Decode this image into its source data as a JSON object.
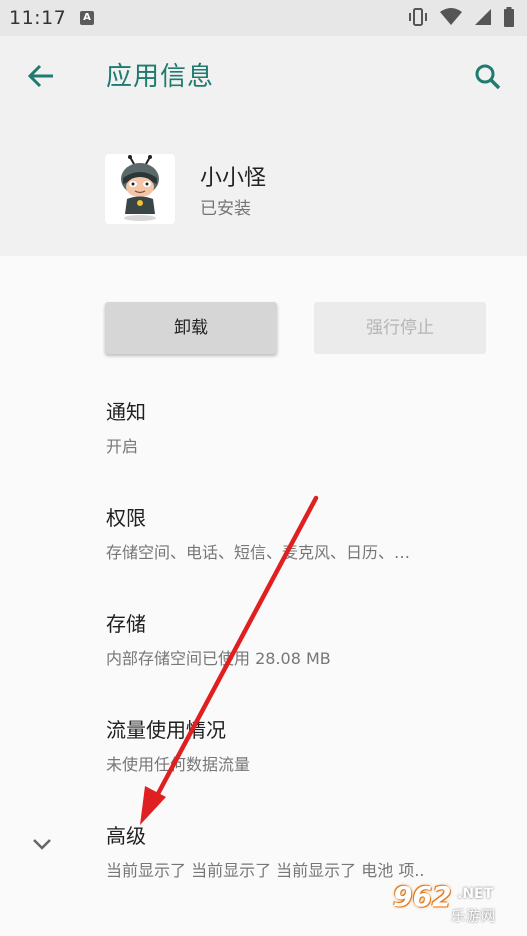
{
  "status_bar": {
    "time": "11:17",
    "notification_badge": "A",
    "icons": [
      "vibrate-icon",
      "wifi-icon",
      "signal-icon",
      "battery-icon"
    ]
  },
  "app_bar": {
    "title": "应用信息",
    "back_icon": "back-arrow-icon",
    "search_icon": "search-icon",
    "accent_color": "#1f7a6f"
  },
  "app_header": {
    "name": "小小怪",
    "status": "已安装"
  },
  "buttons": {
    "uninstall": "卸载",
    "force_stop": "强行停止"
  },
  "settings": [
    {
      "title": "通知",
      "subtitle": "开启"
    },
    {
      "title": "权限",
      "subtitle": "存储空间、电话、短信、麦克风、日历、…"
    },
    {
      "title": "存储",
      "subtitle": "内部存储空间已使用 28.08 MB"
    },
    {
      "title": "流量使用情况",
      "subtitle": "未使用任何数据流量"
    },
    {
      "title": "高级",
      "subtitle": "当前显示了 当前显示了 当前显示了 电池 项.."
    }
  ],
  "watermark": {
    "number": "962",
    "domain": ".NET",
    "text": "乐游网"
  },
  "annotation_color": "#e02020"
}
